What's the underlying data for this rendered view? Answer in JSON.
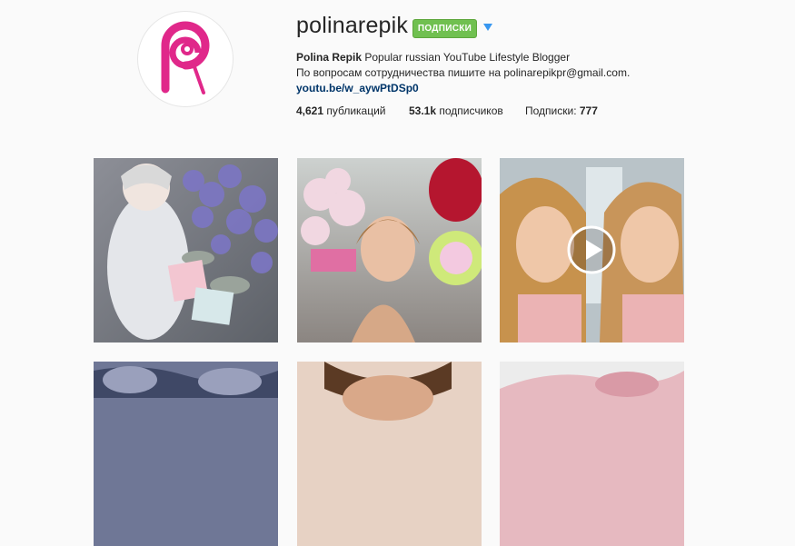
{
  "profile": {
    "username": "polinarepik",
    "follow_label": "ПОДПИСКИ",
    "display_name": "Polina Repik",
    "bio_line1": "Popular russian YouTube Lifestyle Blogger",
    "bio_line2": "По вопросам сотрудничества пишите на polinarepikpr@gmail.com.",
    "link": "youtu.be/w_aywPtDSp0"
  },
  "stats": {
    "posts_count": "4,621",
    "posts_label": "публикаций",
    "followers_count": "53.1k",
    "followers_label": "подписчиков",
    "following_label": "Подписки:",
    "following_count": "777"
  },
  "grid": {
    "tiles": [
      {
        "name": "post-baby-flowers",
        "video": false
      },
      {
        "name": "post-woman-balloons",
        "video": false
      },
      {
        "name": "post-selfie-video",
        "video": true
      },
      {
        "name": "post-blue-fabric",
        "video": false
      },
      {
        "name": "post-portrait",
        "video": false
      },
      {
        "name": "post-pink-blanket",
        "video": false
      }
    ]
  },
  "colors": {
    "follow_green": "#70c050",
    "accent_blue": "#3897f0",
    "link_blue": "#003569",
    "logo_magenta": "#e0288a"
  }
}
